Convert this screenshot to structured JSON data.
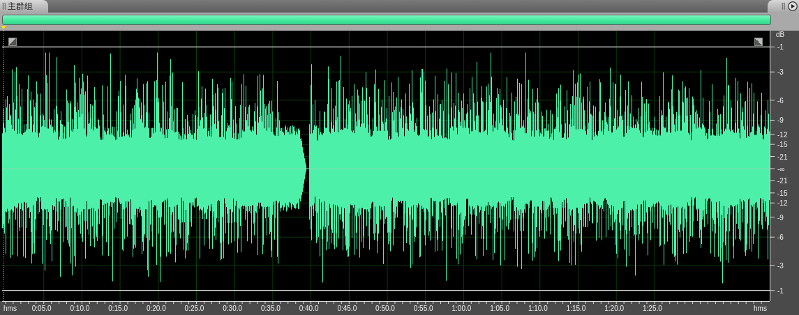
{
  "panel": {
    "tab_label": "主群组"
  },
  "db_ruler": {
    "unit": "dB",
    "ticks": [
      "-1",
      "-3",
      "-6",
      "-9",
      "-12",
      "-15",
      "-21",
      "-∞",
      "-21",
      "-15",
      "-12",
      "-9",
      "-6",
      "-3",
      "-1"
    ]
  },
  "time_ruler": {
    "unit_start": "hms",
    "ticks": [
      "0:05.0",
      "0:10.0",
      "0:15.0",
      "0:20.0",
      "0:25.0",
      "0:30.0",
      "0:35.0",
      "0:40.0",
      "0:45.0",
      "0:50.0",
      "0:55.0",
      "1:00.0",
      "1:05.0",
      "1:10.0",
      "1:15.0",
      "1:20.0",
      "1:25.0"
    ],
    "unit_end": "hms"
  }
}
